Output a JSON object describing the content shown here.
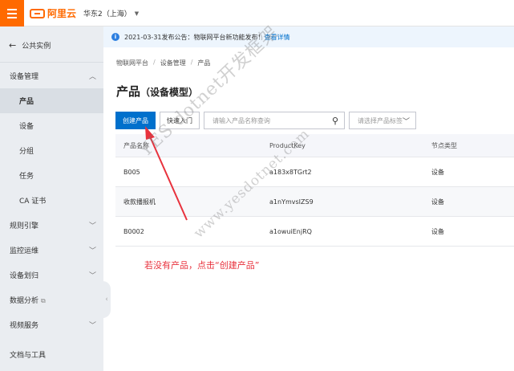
{
  "topbar": {
    "menu_icon": "hamburger-menu-icon",
    "logo_text": "阿里云",
    "region": "华东2（上海）"
  },
  "sidebar": {
    "back_label": "公共实例",
    "items": [
      {
        "label": "设备管理",
        "expanded": true
      },
      {
        "label": "产品",
        "active": true
      },
      {
        "label": "设备"
      },
      {
        "label": "分组"
      },
      {
        "label": "任务"
      },
      {
        "label": "CA 证书"
      },
      {
        "label": "规则引擎"
      },
      {
        "label": "监控运维"
      },
      {
        "label": "设备划归"
      },
      {
        "label": "数据分析"
      },
      {
        "label": "视频服务"
      },
      {
        "label": "文档与工具"
      }
    ]
  },
  "notice": {
    "text": "2021-03-31发布公告：物联网平台新功能发布！",
    "link": "查看详情"
  },
  "breadcrumb": [
    "物联网平台",
    "设备管理",
    "产品"
  ],
  "page": {
    "title": "产品",
    "subtitle": "（设备模型）"
  },
  "toolbar": {
    "create_label": "创建产品",
    "quick_label": "快速入门",
    "search_placeholder": "请输入产品名称查询",
    "tag_placeholder": "请选择产品标签"
  },
  "table": {
    "headers": [
      "产品名称",
      "ProductKey",
      "节点类型"
    ],
    "rows": [
      [
        "B005",
        "a183x8TGrt2",
        "设备"
      ],
      [
        "收款播报机",
        "a1nYmvsIZS9",
        "设备"
      ],
      [
        "B0002",
        "a1owuiEnjRQ",
        "设备"
      ]
    ]
  },
  "annotation": "若没有产品，点击“创建产品”",
  "watermark": {
    "line1": "YES dotnet开发框架",
    "line2": "www.yesdotnet.com"
  },
  "colors": {
    "brand": "#ff6a00",
    "primary": "#0070cc",
    "annotation": "#e8323d"
  }
}
